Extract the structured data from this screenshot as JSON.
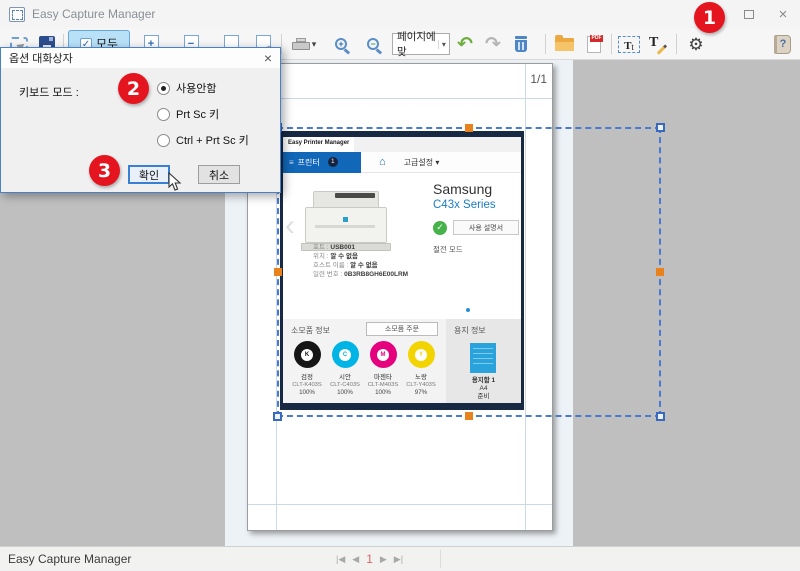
{
  "window": {
    "title": "Easy Capture Manager"
  },
  "titlebar": {
    "close_glyph": "×"
  },
  "toolbar": {
    "select_all_label": "모두",
    "plus": "+",
    "minus": "−",
    "fit_value": "페이지에 맞",
    "fit_caret": "▾",
    "undo_glyph": "↶",
    "redo_glyph": "↷",
    "pdf_tag": "PDF",
    "text_select_T": "T",
    "text_select_t": "t",
    "text_edit_T": "T",
    "gear_glyph": "⚙",
    "help_label": "?",
    "zoom_in_sign": "+",
    "zoom_out_sign": "−",
    "printer_caret": "▾",
    "check_glyph": "✓",
    "menu_glyph": "≡"
  },
  "canvas": {
    "page_indicator": "1/1"
  },
  "captured": {
    "app_title": "Easy Printer Manager",
    "menu_glyph": "≡",
    "tab_printer": "프린터",
    "tab_badge": "1",
    "home_glyph": "⌂",
    "advanced": "고급설정 ▾",
    "chevron": "‹",
    "brand": "Samsung",
    "model": "C43x Series",
    "check_glyph": "✓",
    "manual_button": "사용 설명서",
    "power_mode": "절전 모드",
    "details": [
      {
        "label": "포트 : ",
        "value": "USB001"
      },
      {
        "label": "위치 : ",
        "value": "알 수 없음"
      },
      {
        "label": "호스트 이름 : ",
        "value": "알 수 없음"
      },
      {
        "label": "일련 번호 : ",
        "value": "0B3RB8GH6E00LRM"
      }
    ],
    "supplies": {
      "title": "소모품 정보",
      "order_button": "소모품 주문",
      "toners": [
        {
          "name": "검정",
          "code": "CLT-K403S",
          "level": "100%",
          "color": "#161616",
          "letter": "K"
        },
        {
          "name": "시안",
          "code": "CLT-C403S",
          "level": "100%",
          "color": "#00b4e5",
          "letter": "C"
        },
        {
          "name": "마젠타",
          "code": "CLT-M403S",
          "level": "100%",
          "color": "#e5007d",
          "letter": "M"
        },
        {
          "name": "노랑",
          "code": "CLT-Y403S",
          "level": "97%",
          "color": "#f2d400",
          "letter": "Y"
        }
      ]
    },
    "paper": {
      "title": "용지 정보",
      "tray": "용지함 1",
      "size": "A4",
      "status": "준비"
    }
  },
  "dialog": {
    "title": "옵션 대화상자",
    "close_glyph": "×",
    "keyboard_mode_label": "키보드 모드 :",
    "options": [
      {
        "label": "사용안함"
      },
      {
        "label": "Prt Sc 키"
      },
      {
        "label": "Ctrl + Prt Sc 키"
      }
    ],
    "ok": "확인",
    "cancel": "취소"
  },
  "annotations": {
    "one": "1",
    "two": "2",
    "three": "3"
  },
  "statusbar": {
    "text": "Easy Capture Manager",
    "nav": {
      "first": "|◀",
      "prev": "◀",
      "page": "1",
      "next": "▶",
      "last": "▶|"
    }
  },
  "colors": {
    "annotation_red": "#e5151f",
    "accent_blue": "#1167b8",
    "selection_blue": "#4a7ad0"
  }
}
